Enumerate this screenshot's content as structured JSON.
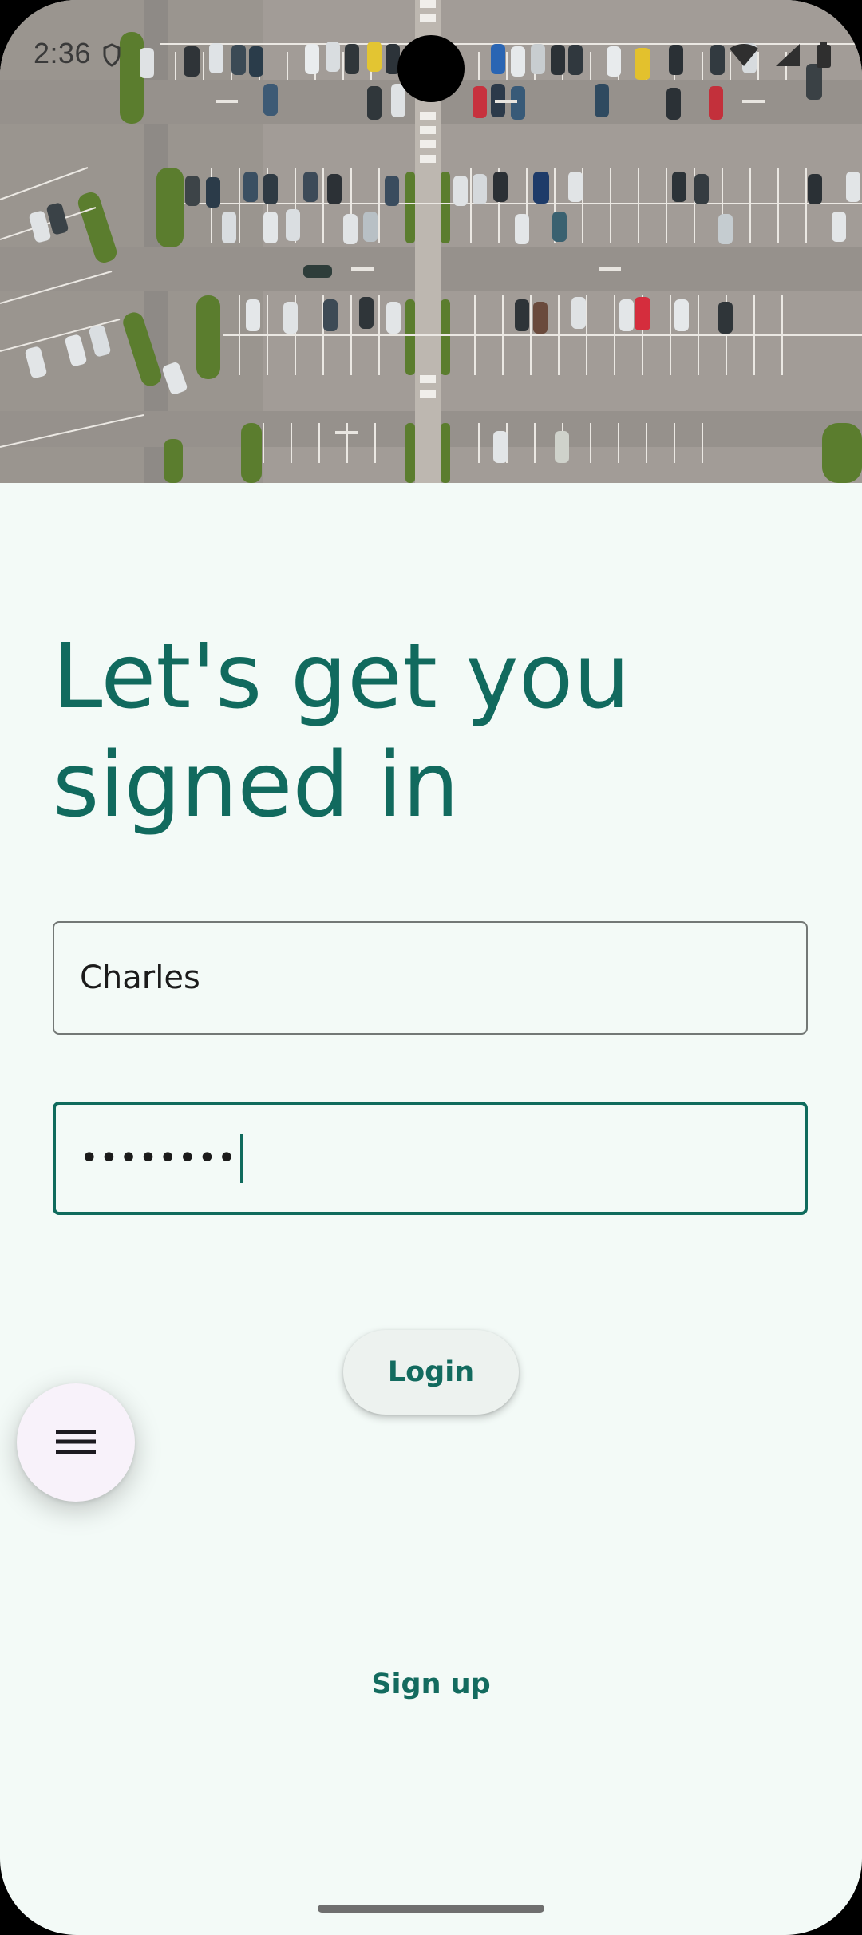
{
  "status_bar": {
    "time": "2:36",
    "icons": [
      "shield-icon",
      "wifi-icon",
      "signal-icon",
      "battery-icon"
    ]
  },
  "hero": {
    "image": "parking-lot-aerial-photo"
  },
  "heading": "Let's get you signed in",
  "form": {
    "username_value": "Charles",
    "password_value": "••••••••"
  },
  "login_label": "Login",
  "menu_icon": "menu-icon",
  "signup_label": "Sign up",
  "colors": {
    "primary": "#116a5e",
    "background": "#f3faf7",
    "button_surface": "#edf2ef",
    "fab_surface": "#f8f2fa"
  }
}
